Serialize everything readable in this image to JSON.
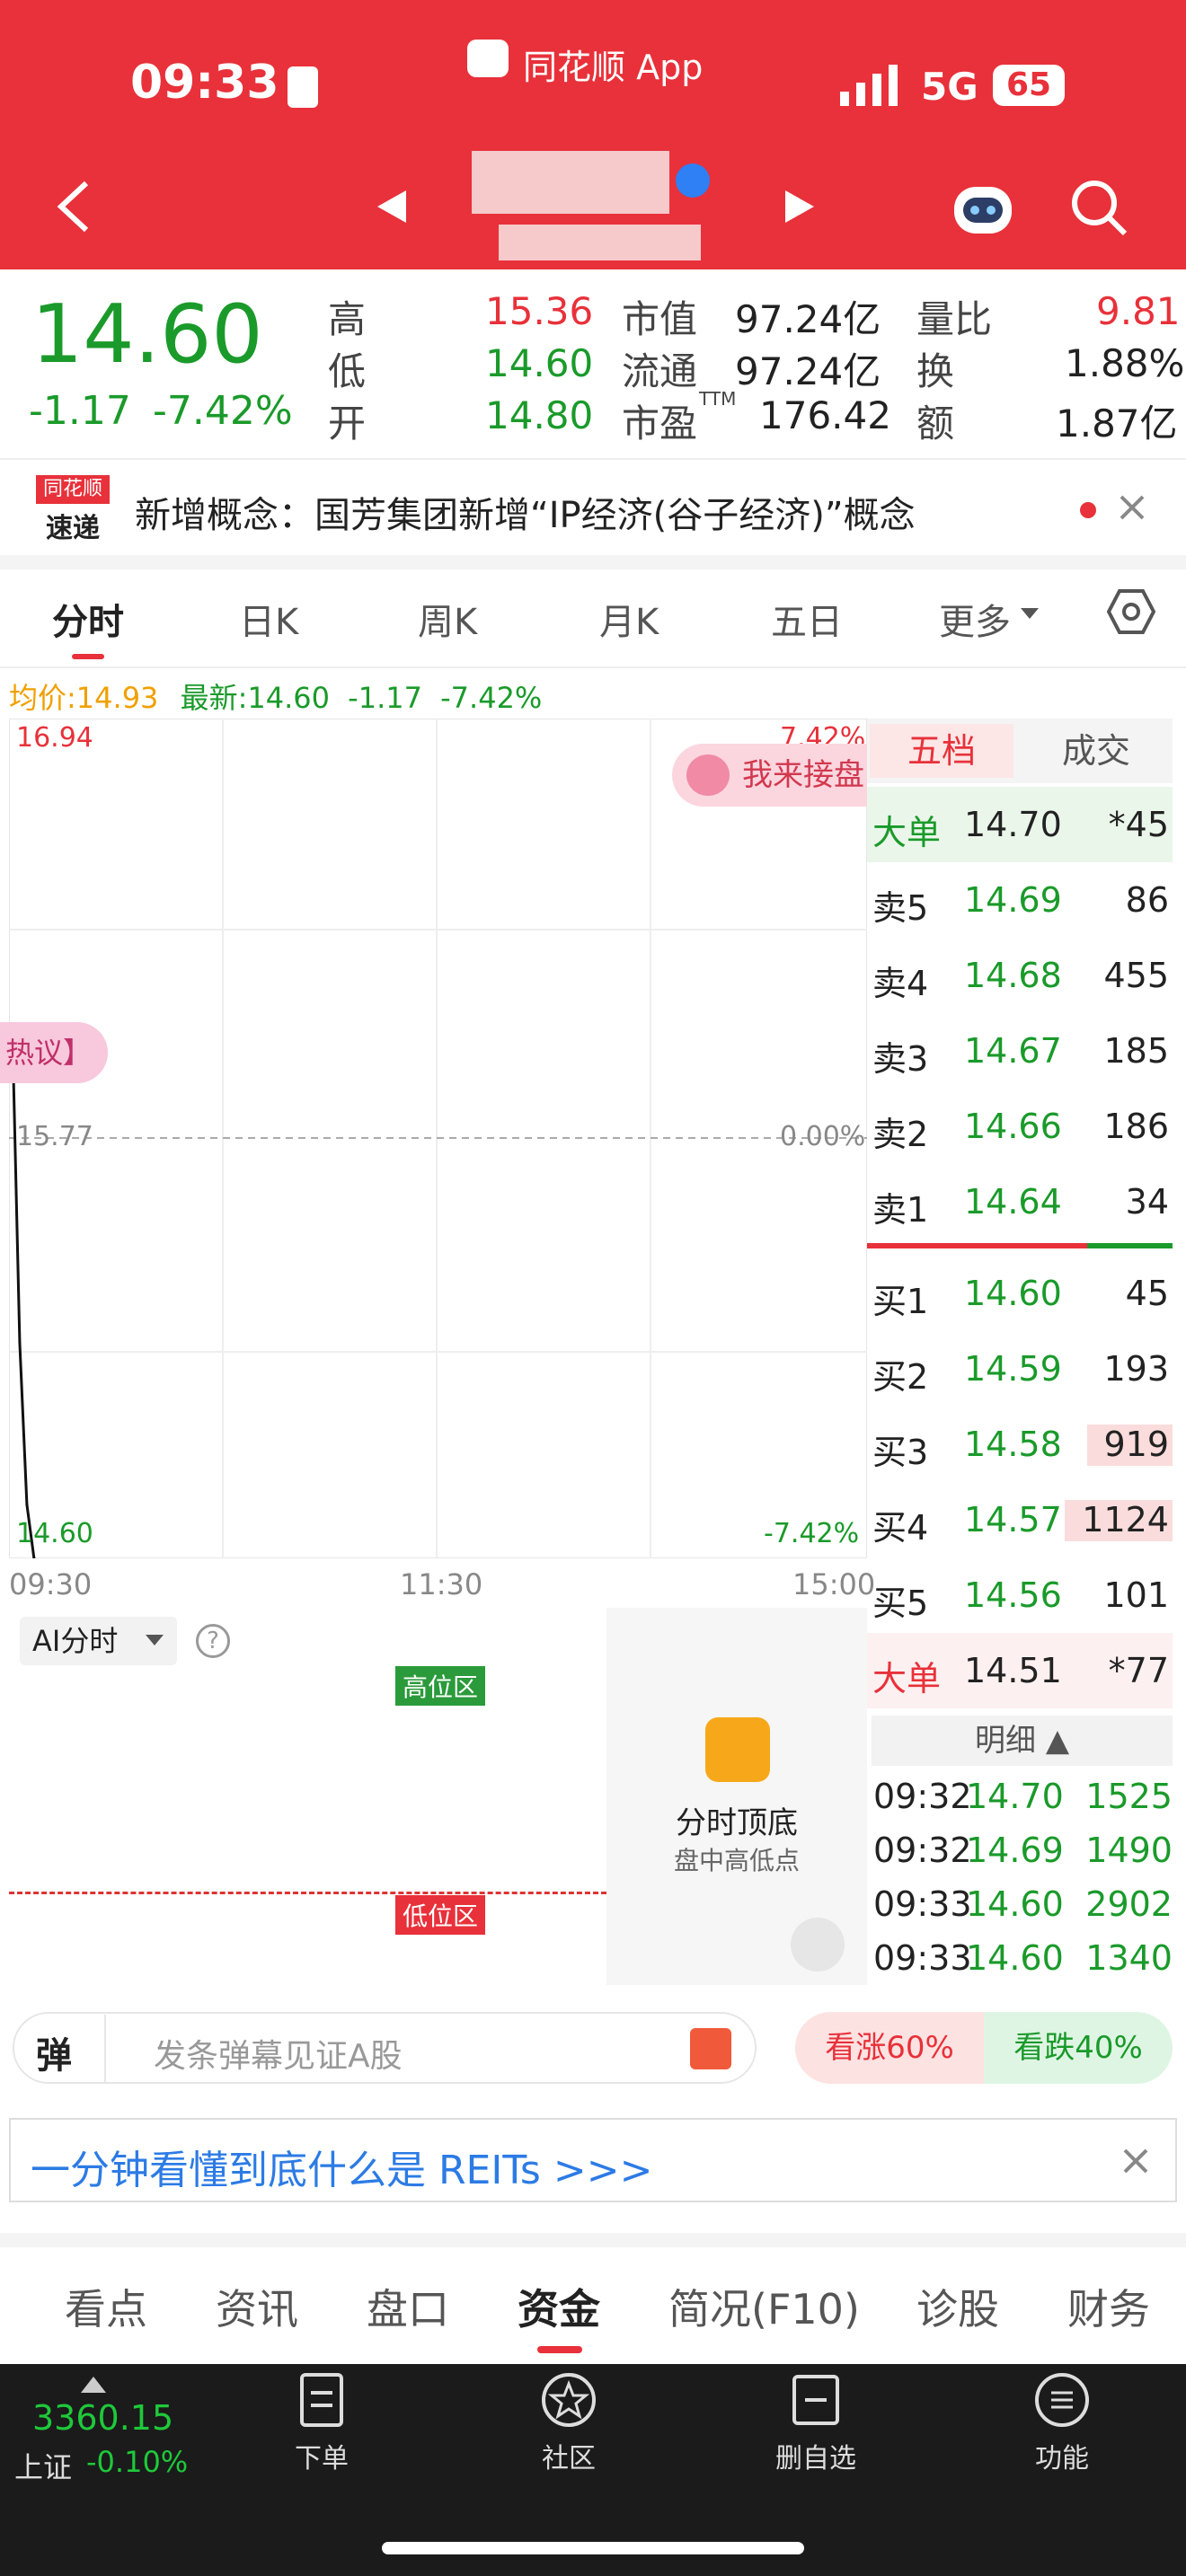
{
  "status": {
    "time": "09:33",
    "app_name": "同花顺 App",
    "network": "5G",
    "battery": "65"
  },
  "quote": {
    "price": "14.60",
    "change": "-1.17",
    "change_pct": "-7.42%",
    "stats": [
      {
        "label": "高",
        "value": "15.36"
      },
      {
        "label": "低",
        "value": "14.60"
      },
      {
        "label": "开",
        "value": "14.80"
      },
      {
        "label": "市值",
        "value": "97.24亿"
      },
      {
        "label": "流通",
        "value": "97.24亿"
      },
      {
        "label": "市盈",
        "sup": "TTM",
        "value": "176.42"
      },
      {
        "label": "量比",
        "value": "9.81"
      },
      {
        "label": "换",
        "value": "1.88%"
      },
      {
        "label": "额",
        "value": "1.87亿"
      }
    ]
  },
  "news": {
    "badge_top": "同花顺",
    "badge_bottom": "速递",
    "text": "新增概念：国芳集团新增“IP经济(谷子经济)”概念"
  },
  "tabs": [
    "分时",
    "日K",
    "周K",
    "月K",
    "五日",
    "更多"
  ],
  "summary": {
    "avg_label": "均价:",
    "avg": "14.93",
    "latest_label": "最新:",
    "latest": "14.60",
    "chg": "-1.17",
    "pct": "-7.42%"
  },
  "chart": {
    "high": "16.94",
    "high_pct": "7.42%",
    "mid": "15.77",
    "mid_pct": "0.00%",
    "low": "14.60",
    "low_pct": "-7.42%",
    "times": [
      "09:30",
      "11:30",
      "15:00"
    ],
    "hot_tag": "热议】",
    "catch_btn": "我来接盘"
  },
  "chart_data": {
    "type": "line",
    "x": [
      "09:30",
      "09:31",
      "09:32",
      "09:33"
    ],
    "series": [
      {
        "values": [
          16.05,
          15.2,
          14.75,
          14.6
        ]
      }
    ],
    "ylim": [
      14.6,
      16.94
    ]
  },
  "ai": {
    "dropdown": "AI分时",
    "high_zone": "高位区",
    "low_zone": "低位区",
    "promo_title": "分时顶底",
    "promo_sub": "盘中高低点"
  },
  "orderbook": {
    "tab_active": "五档",
    "tab_other": "成交",
    "big_sell": {
      "label": "大单",
      "price": "14.70",
      "vol": "*45"
    },
    "asks": [
      {
        "label": "卖5",
        "price": "14.69",
        "vol": "86"
      },
      {
        "label": "卖4",
        "price": "14.68",
        "vol": "455"
      },
      {
        "label": "卖3",
        "price": "14.67",
        "vol": "185"
      },
      {
        "label": "卖2",
        "price": "14.66",
        "vol": "186"
      },
      {
        "label": "卖1",
        "price": "14.64",
        "vol": "34"
      }
    ],
    "bids": [
      {
        "label": "买1",
        "price": "14.60",
        "vol": "45"
      },
      {
        "label": "买2",
        "price": "14.59",
        "vol": "193"
      },
      {
        "label": "买3",
        "price": "14.58",
        "vol": "919"
      },
      {
        "label": "买4",
        "price": "14.57",
        "vol": "1124"
      },
      {
        "label": "买5",
        "price": "14.56",
        "vol": "101"
      }
    ],
    "big_buy": {
      "label": "大单",
      "price": "14.51",
      "vol": "*77"
    },
    "detail_label": "明细",
    "details": [
      {
        "t": "09:32",
        "p": "14.70",
        "v": "1525"
      },
      {
        "t": "09:32",
        "p": "14.69",
        "v": "1490"
      },
      {
        "t": "09:33",
        "p": "14.60",
        "v": "2902"
      },
      {
        "t": "09:33",
        "p": "14.60",
        "v": "1340"
      }
    ]
  },
  "danmu": {
    "icon": "弹",
    "placeholder": "发条弹幕见证A股",
    "up": "看涨60%",
    "down": "看跌40%"
  },
  "banner": "一分钟看懂到底什么是 REITs >>>",
  "bottom_tabs": [
    "看点",
    "资讯",
    "盘口",
    "资金",
    "简况(F10)",
    "诊股",
    "财务"
  ],
  "index": {
    "value": "3360.15",
    "name": "上证",
    "pct": "-0.10%"
  },
  "nav": [
    "下单",
    "社区",
    "删自选",
    "功能"
  ]
}
